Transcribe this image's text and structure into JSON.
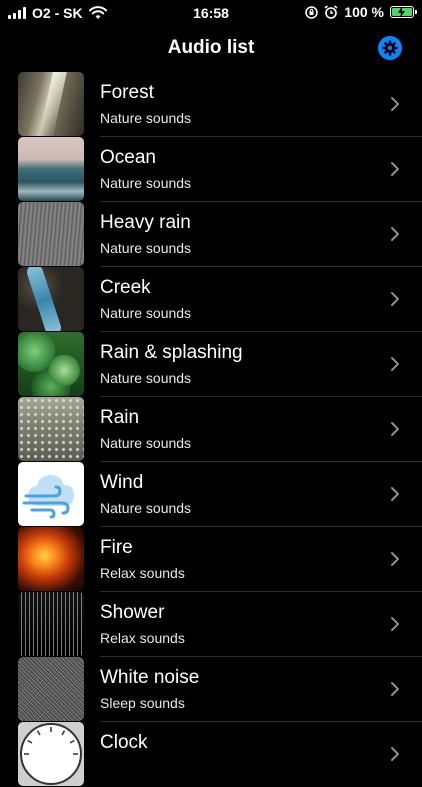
{
  "status_bar": {
    "carrier": "O2 - SK",
    "time": "16:58",
    "battery": "100 %"
  },
  "nav": {
    "title": "Audio list",
    "settings_icon": "gear-icon"
  },
  "colors": {
    "accent": "#0a84ff",
    "separator": "#2c2c2e",
    "chevron": "#8e8e93",
    "battery_green": "#4cd964"
  },
  "items": [
    {
      "title": "Forest",
      "subtitle": "Nature sounds",
      "thumb": "forest"
    },
    {
      "title": "Ocean",
      "subtitle": "Nature sounds",
      "thumb": "ocean"
    },
    {
      "title": "Heavy rain",
      "subtitle": "Nature sounds",
      "thumb": "heavy-rain"
    },
    {
      "title": "Creek",
      "subtitle": "Nature sounds",
      "thumb": "creek"
    },
    {
      "title": "Rain & splashing",
      "subtitle": "Nature sounds",
      "thumb": "rain-splashing"
    },
    {
      "title": "Rain",
      "subtitle": "Nature sounds",
      "thumb": "rain"
    },
    {
      "title": "Wind",
      "subtitle": "Nature sounds",
      "thumb": "wind"
    },
    {
      "title": "Fire",
      "subtitle": "Relax sounds",
      "thumb": "fire"
    },
    {
      "title": "Shower",
      "subtitle": "Relax sounds",
      "thumb": "shower"
    },
    {
      "title": "White noise",
      "subtitle": "Sleep sounds",
      "thumb": "white-noise"
    },
    {
      "title": "Clock",
      "subtitle": "",
      "thumb": "clock"
    }
  ]
}
